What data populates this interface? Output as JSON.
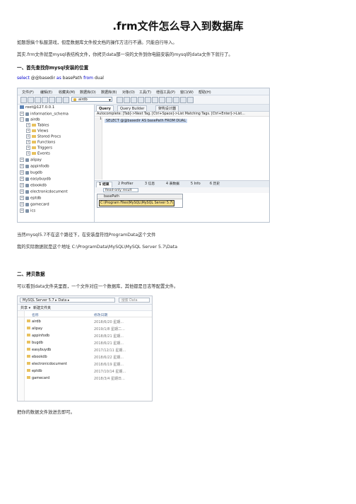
{
  "title": ".frm文件怎么导入到数据库",
  "intro1": "如题想搞个私服游戏，但是数据库文件按文档的操作方法行不通。只能自行导入。",
  "intro2": "其实.frm文件就是mysql表结构文件，你拷贝data那一块的文件到你电脑安装的mysql的data文件下就行了。",
  "section1": "一、首先查找你mysql安装的位置",
  "code": {
    "kw1": "select",
    "var": "@@basedir",
    "kw2": "as",
    "alias": "basePath",
    "kw3": "from",
    "table": "dual"
  },
  "app": {
    "menu": [
      "文件(F)",
      "编辑(E)",
      "收藏夹(M)",
      "数据库(D)",
      "数据库(B)",
      "对象(O)",
      "工具(T)",
      "增强工具(P)",
      "窗口(W)",
      "帮助(H)"
    ],
    "db_selected": "airdb",
    "tree": {
      "root": "root@127.0.0.1",
      "items": [
        "information_schema",
        "airdb",
        "Tables",
        "Views",
        "Stored Procs",
        "Functions",
        "Triggers",
        "Events",
        "alipay",
        "appinfodb",
        "bugdb",
        "easybuydb",
        "ebookdb",
        "electronicdocument",
        "eptdb",
        "gamecard",
        "ics"
      ]
    },
    "query_tabs": [
      "Query",
      "Query Builder",
      "架构设计器"
    ],
    "autocomplete": "Autocomplete: [Tab]->Next Tag. [Ctrl+Space]->List Matching Tags. [Ctrl+Enter]->List...",
    "sql": "SELECT @@basedir AS basePath FROM DUAL",
    "line_no": "1",
    "result_tabs": [
      "1 结果",
      "2 Profiler",
      "3 信息",
      "4 表数据",
      "5 Info",
      "6 历史"
    ],
    "readonly": "Read-only result",
    "result_col": "basePath",
    "result_val": "C:\\Program Files\\MySQL\\MySQL Server 5.7\\"
  },
  "note1": "当然mysql5.7不在这个路径下，在安装盘符找ProgramData这个文件",
  "note2": "我的实际数据就是这个地址  C:\\ProgramData\\MySQL\\MySQL Server 5.7\\Data",
  "section2": "二、拷贝数据",
  "note3": "可以看到data文件夹里面，一个文件对应一个数据库，其他都是日志等配置文件。",
  "explorer": {
    "path": "MySQL Server 5.7  ▸  Data  ▸",
    "search_placeholder": "搜索 Data",
    "toolbar": [
      "共享 ▾",
      "新建文件夹"
    ],
    "col_name": "名称",
    "col_date": "修改日期",
    "rows": [
      {
        "name": "airdb",
        "date": "2018/6/20 星期..."
      },
      {
        "name": "alipay",
        "date": "2019/1/8 星期二..."
      },
      {
        "name": "appinfodb",
        "date": "2018/8/21 星期..."
      },
      {
        "name": "bugdb",
        "date": "2018/6/21 星期..."
      },
      {
        "name": "easybuydb",
        "date": "2017/12/11 星期..."
      },
      {
        "name": "ebookdb",
        "date": "2018/6/22 星期..."
      },
      {
        "name": "electronicdocument",
        "date": "2018/6/19 星期..."
      },
      {
        "name": "eptdb",
        "date": "2017/10/14 星期..."
      },
      {
        "name": "gamecard",
        "date": "2018/3/4 星期日..."
      }
    ]
  },
  "final": "把你的数据文件放进去即可。"
}
